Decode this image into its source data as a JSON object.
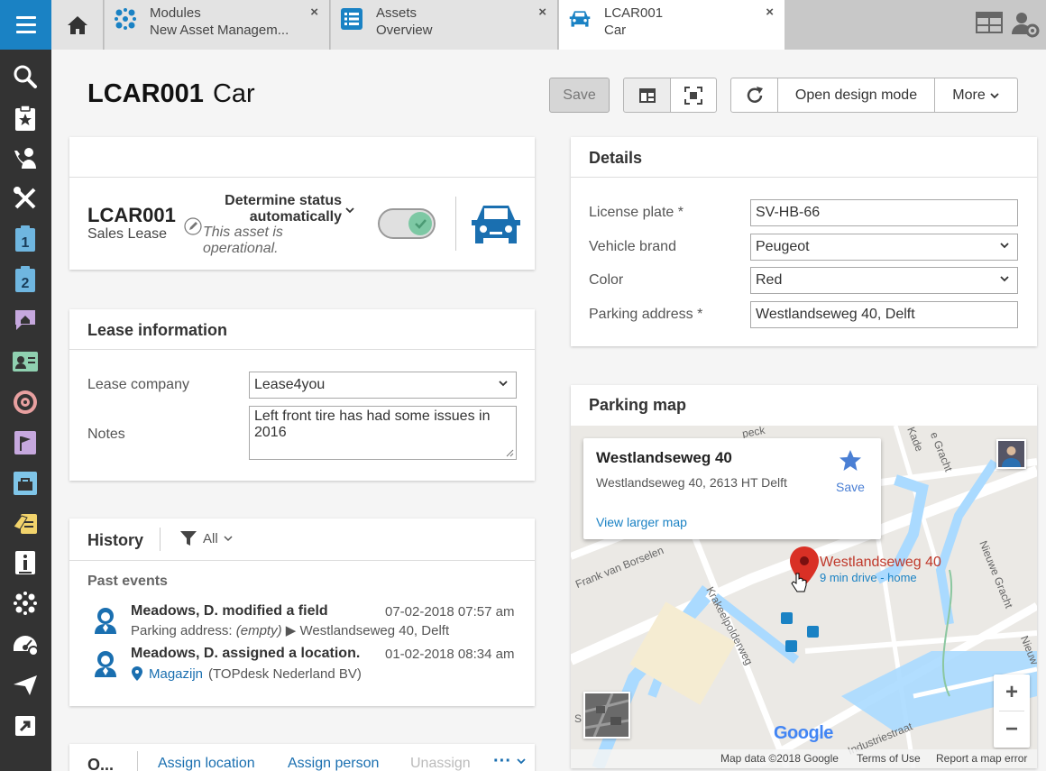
{
  "tabs": [
    {
      "line1": "Modules",
      "line2": "New Asset Managem...",
      "close": "×",
      "icon": "modules-icon"
    },
    {
      "line1": "Assets",
      "line2": "Overview",
      "close": "×",
      "icon": "list-icon"
    },
    {
      "line1": "LCAR001",
      "line2": "Car",
      "close": "×",
      "icon": "car-icon"
    }
  ],
  "header": {
    "id": "LCAR001",
    "type": "Car"
  },
  "toolbar": {
    "save": "Save",
    "design": "Open design mode",
    "more": "More"
  },
  "summary": {
    "id": "LCAR001",
    "subtitle": "Sales Lease",
    "status_title": "Determine status automatically",
    "status_text": "This asset is operational.",
    "toggle_on": true
  },
  "details": {
    "title": "Details",
    "fields": [
      {
        "label": "License plate *",
        "value": "SV-HB-66",
        "type": "text"
      },
      {
        "label": "Vehicle brand",
        "value": "Peugeot",
        "type": "select"
      },
      {
        "label": "Color",
        "value": "Red",
        "type": "select"
      },
      {
        "label": "Parking address *",
        "value": "Westlandseweg 40, Delft",
        "type": "text"
      }
    ]
  },
  "lease": {
    "title": "Lease information",
    "company_label": "Lease company",
    "company_value": "Lease4you",
    "notes_label": "Notes",
    "notes_value": "Left front tire has had some issues in 2016"
  },
  "history": {
    "title": "History",
    "filter": "All",
    "section": "Past events",
    "events": [
      {
        "title": "Meadows, D. modified a field",
        "date": "07-02-2018 07:57 am",
        "field": "Parking address:",
        "old": "(empty)",
        "arrow": "▶",
        "new": "Westlandseweg 40, Delft"
      },
      {
        "title": "Meadows, D. assigned a location.",
        "date": "01-02-2018 08:34 am",
        "location": "Magazijn",
        "org": "(TOPdesk Nederland BV)"
      }
    ]
  },
  "bottom": {
    "title": "O...",
    "actions": [
      "Assign location",
      "Assign person",
      "Unassign"
    ],
    "more": "···"
  },
  "map": {
    "title": "Parking map",
    "popup_title": "Westlandseweg 40",
    "popup_addr": "Westlandseweg 40, 2613 HT Delft",
    "popup_save": "Save",
    "popup_link": "View larger map",
    "pin_label": "Westlandseweg 40",
    "pin_sub": "9 min drive - home",
    "streets": [
      "Frank van Borselen",
      "Krakeelpolderweg",
      "Nieuwe Gracht",
      "e Gracht",
      "Kade",
      "Industriestraat",
      "Nieuw",
      "peck",
      "S"
    ],
    "footer": [
      "Map data ©2018 Google",
      "Terms of Use",
      "Report a map error"
    ],
    "google": "Google",
    "zoom_in": "+",
    "zoom_out": "−"
  },
  "colors": {
    "accent": "#1a82c4",
    "sidebar": "#333333",
    "toggle": "#7dc8a4",
    "pin": "#d93025"
  }
}
